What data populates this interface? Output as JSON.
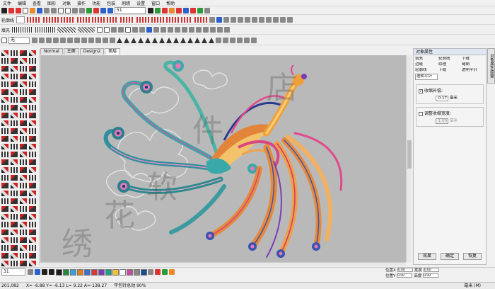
{
  "menu": [
    "文件",
    "编辑",
    "查看",
    "图形",
    "对象",
    "操作",
    "功能",
    "包装",
    "刺绣",
    "设置",
    "窗口",
    "帮助"
  ],
  "toolbar": {
    "zoom_value": "51",
    "stitch_label": "轮廓线",
    "fill_label": "填充",
    "layer_select": "无"
  },
  "tabs": [
    {
      "label": "Normal"
    },
    {
      "label": "主面"
    },
    {
      "label": "Design2"
    },
    {
      "label": "面层"
    }
  ],
  "panel": {
    "title": "对象属性",
    "side_tab": "对象属性/图案",
    "tabs": [
      "填充",
      "轮廓线",
      "下缝",
      "边缝",
      "纹理",
      "缝制"
    ],
    "tab2": [
      "轮廓线",
      "下缝",
      "透明平针",
      "透明填充"
    ],
    "active_tab": "透明平针",
    "opt1_label": "收缩补偿:",
    "opt1_value": "0.17",
    "unit": "毫米",
    "opt2_label": "调整收缩宽度:",
    "opt2_value": "1.00",
    "unit2": "毫米",
    "btn_apply": "效果",
    "btn_ok": "确定",
    "btn_reset": "恢复"
  },
  "bottom": {
    "thread_no": "31",
    "colors": [
      "#1b1b1b",
      "#228a3c",
      "#3aa0d8",
      "#e07b1f",
      "#3b6fd6",
      "#d43a3a",
      "#7a3fb8",
      "#1f9e8c",
      "#f2c230",
      "#ffffff",
      "#c44f9a",
      "#888888",
      "#1a4d8f"
    ],
    "pos_x_label": "位置X",
    "pos_y_label": "位置Y",
    "width_label": "宽度",
    "height_label": "高度",
    "pos_x": "0.00",
    "pos_y": "0.00",
    "w": "0.00",
    "h": "0.00"
  },
  "status": {
    "count": "201,082",
    "x": "X= -6.88 Y= -6.13 L= 9.22 A=-138.27",
    "info": "平包针总动 90%",
    "right": "毫米 (M)"
  },
  "watermark": "绣 花 软 件 店"
}
